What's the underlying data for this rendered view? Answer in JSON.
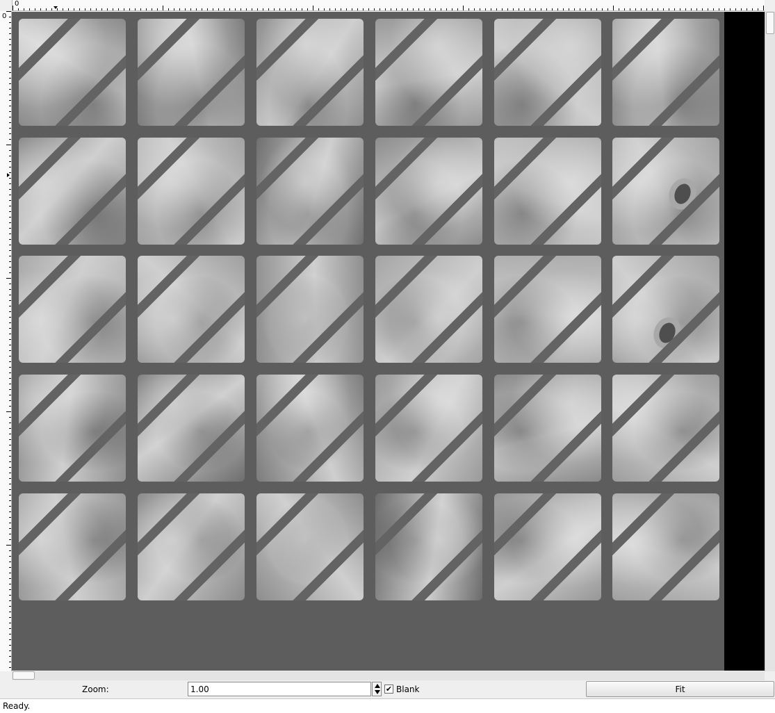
{
  "ruler": {
    "top_origin_label": "0",
    "left_origin_label": "0"
  },
  "zoom": {
    "label": "Zoom:",
    "value": "1.00"
  },
  "blank": {
    "label": "Blank",
    "checked": true
  },
  "fit_button": {
    "label": "Fit"
  },
  "status": {
    "text": "Ready."
  },
  "icons": [
    "checkbox-check-icon",
    "spinner-up-icon",
    "spinner-down-icon"
  ]
}
